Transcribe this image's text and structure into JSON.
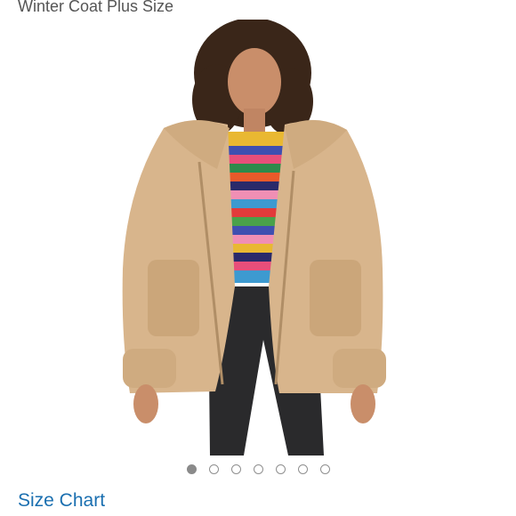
{
  "product": {
    "title": "Winter Coat Plus Size"
  },
  "gallery": {
    "image_subject": "model wearing tan teddy jacket over rainbow striped sweater and black jeans",
    "dot_count": 7,
    "active_index": 0
  },
  "links": {
    "size_chart": "Size Chart"
  },
  "colors": {
    "link": "#1a6fb0",
    "coat": "#d8b58c",
    "title": "#555555"
  }
}
